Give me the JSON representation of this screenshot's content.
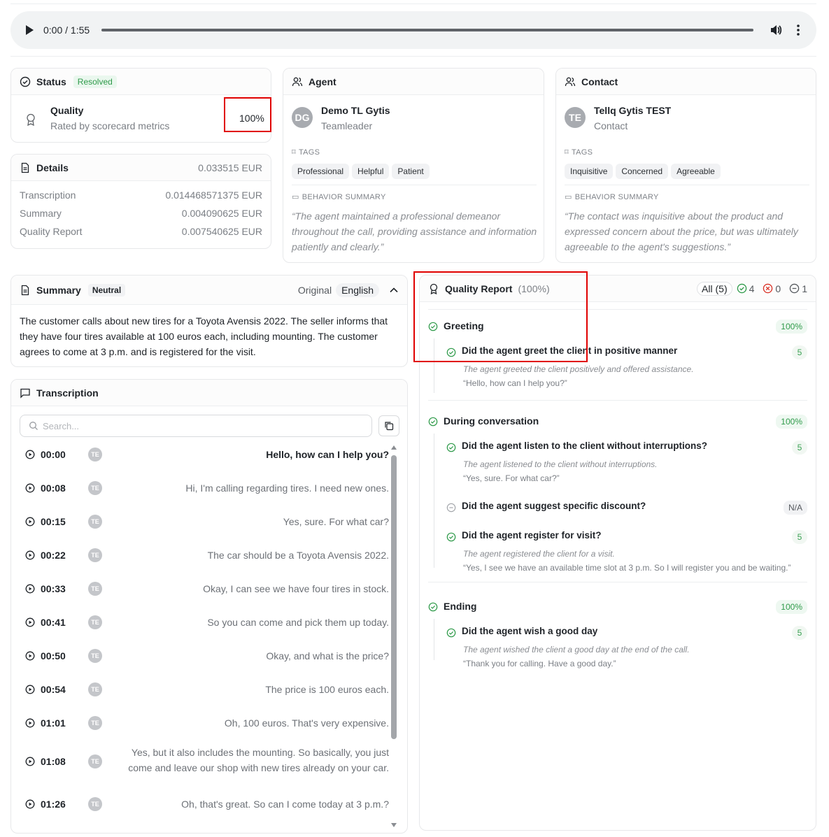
{
  "player": {
    "time": "0:00 / 1:55"
  },
  "status": {
    "title": "Status",
    "badge": "Resolved",
    "quality_title": "Quality",
    "quality_sub": "Rated by scorecard metrics",
    "quality_value": "100%"
  },
  "details": {
    "title": "Details",
    "total": "0.033515 EUR",
    "rows": [
      {
        "label": "Transcription",
        "value": "0.014468571375 EUR"
      },
      {
        "label": "Summary",
        "value": "0.004090625 EUR"
      },
      {
        "label": "Quality Report",
        "value": "0.007540625 EUR"
      }
    ]
  },
  "agent": {
    "title": "Agent",
    "initials": "DG",
    "name": "Demo TL Gytis",
    "role": "Teamleader",
    "tags_label": "TAGS",
    "tags": [
      "Professional",
      "Helpful",
      "Patient"
    ],
    "behavior_label": "BEHAVIOR SUMMARY",
    "behavior": "“The agent maintained a professional demeanor throughout the call, providing assistance and information patiently and clearly.”"
  },
  "contact": {
    "title": "Contact",
    "initials": "TE",
    "name": "Tellq Gytis TEST",
    "role": "Contact",
    "tags_label": "TAGS",
    "tags": [
      "Inquisitive",
      "Concerned",
      "Agreeable"
    ],
    "behavior_label": "BEHAVIOR SUMMARY",
    "behavior": "“The contact was inquisitive about the product and expressed concern about the price, but was ultimately agreeable to the agent's suggestions.”"
  },
  "summary": {
    "title": "Summary",
    "badge": "Neutral",
    "toggle_original": "Original",
    "toggle_english": "English",
    "text": "The customer calls about new tires for a Toyota Avensis 2022. The seller informs that they have four tires available at 100 euros each, including mounting. The customer agrees to come at 3 p.m. and is registered for the visit."
  },
  "transcription": {
    "title": "Transcription",
    "search_placeholder": "Search...",
    "avatar": "TE",
    "rows": [
      {
        "time": "00:00",
        "text": "Hello, how can I help you?"
      },
      {
        "time": "00:08",
        "text": "Hi, I'm calling regarding tires. I need new ones."
      },
      {
        "time": "00:15",
        "text": "Yes, sure. For what car?"
      },
      {
        "time": "00:22",
        "text": "The car should be a Toyota Avensis 2022."
      },
      {
        "time": "00:33",
        "text": "Okay, I can see we have four tires in stock."
      },
      {
        "time": "00:41",
        "text": "So you can come and pick them up today."
      },
      {
        "time": "00:50",
        "text": "Okay, and what is the price?"
      },
      {
        "time": "00:54",
        "text": "The price is 100 euros each."
      },
      {
        "time": "01:01",
        "text": "Oh, 100 euros. That's very expensive."
      },
      {
        "time": "01:08",
        "text": "Yes, but it also includes the mounting. So basically, you just come and leave our shop with new tires already on your car."
      },
      {
        "time": "01:26",
        "text": "Oh, that's great. So can I come today at 3 p.m.?"
      }
    ]
  },
  "quality_report": {
    "title": "Quality Report",
    "percent": "(100%)",
    "filter_all": "All (5)",
    "count_pass": "4",
    "count_fail": "0",
    "count_na": "1",
    "sections": [
      {
        "name": "Greeting",
        "score": "100%",
        "items": [
          {
            "q": "Did the agent greet the client in positive manner",
            "score": "5",
            "note": "The agent greeted the client positively and offered assistance.",
            "quote": "“Hello, how can I help you?”"
          }
        ]
      },
      {
        "name": "During conversation",
        "score": "100%",
        "items": [
          {
            "q": "Did the agent listen to the client without interruptions?",
            "score": "5",
            "note": "The agent listened to the client without interruptions.",
            "quote": "“Yes, sure. For what car?”"
          },
          {
            "q": "Did the agent suggest specific discount?",
            "score": "N/A",
            "note": "",
            "quote": ""
          },
          {
            "q": "Did the agent register for visit?",
            "score": "5",
            "note": "The agent registered the client for a visit.",
            "quote": "“Yes, I see we have an available time slot at 3 p.m. So I will register you and be waiting.”"
          }
        ]
      },
      {
        "name": "Ending",
        "score": "100%",
        "items": [
          {
            "q": "Did the agent wish a good day",
            "score": "5",
            "note": "The agent wished the client a good day at the end of the call.",
            "quote": "“Thank you for calling. Have a good day.”"
          }
        ]
      }
    ]
  },
  "colors": {
    "green": "#2e9a49",
    "red": "#e00000",
    "highlight": "#e00000"
  }
}
